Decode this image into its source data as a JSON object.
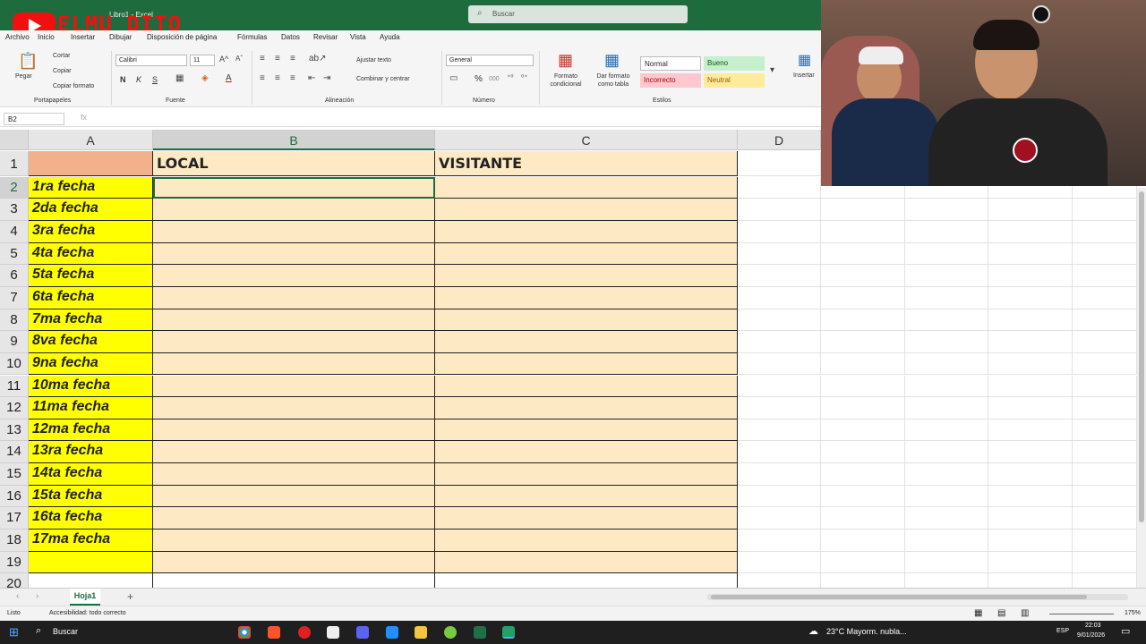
{
  "window": {
    "title": "Libro1 - Excel",
    "watermark": "ELMU_DITO",
    "search_placeholder": "Buscar"
  },
  "menu": {
    "items": [
      "Archivo",
      "Inicio",
      "Insertar",
      "Dibujar",
      "Disposición de página",
      "Fórmulas",
      "Datos",
      "Revisar",
      "Vista",
      "Ayuda"
    ]
  },
  "ribbon": {
    "paste": "Pegar",
    "cut": "Cortar",
    "copy": "Copiar",
    "format_painter": "Copiar formato",
    "clipboard_group": "Portapapeles",
    "font_name": "Calibri",
    "font_size": "11",
    "bold": "N",
    "italic": "K",
    "underline": "S",
    "font_group": "Fuente",
    "wrap_text": "Ajustar texto",
    "merge_center": "Combinar y centrar",
    "alignment_group": "Alineación",
    "number_format": "General",
    "percent": "%",
    "thousands": "000",
    "number_group": "Número",
    "conditional_format": "Formato condicional",
    "format_table": "Dar formato como tabla",
    "styles": {
      "normal": "Normal",
      "good": "Bueno",
      "bad": "Incorrecto",
      "neutral": "Neutral"
    },
    "styles_group": "Estilos",
    "insert": "Insertar"
  },
  "formula_bar": {
    "name_box": "B2",
    "fx": "fx",
    "value": ""
  },
  "sheet": {
    "columns": [
      "A",
      "B",
      "C",
      "D"
    ],
    "rows": [
      "1",
      "2",
      "3",
      "4",
      "5",
      "6",
      "7",
      "8",
      "9",
      "10",
      "11",
      "12",
      "13",
      "14",
      "15",
      "16",
      "17",
      "18",
      "19",
      "20"
    ],
    "header_b": "LOCAL",
    "header_c": "VISITANTE",
    "col_a": [
      "",
      "1ra fecha",
      "2da fecha",
      "3ra fecha",
      "4ta fecha",
      "5ta fecha",
      "6ta fecha",
      "7ma fecha",
      "8va fecha",
      "9na fecha",
      "10ma fecha",
      "11ma fecha",
      "12ma fecha",
      "13ra fecha",
      "14ta fecha",
      "15ta fecha",
      "16ta fecha",
      "17ma fecha",
      ""
    ],
    "colors": {
      "col_a_header": "#f2b08b",
      "col_a": "#ffff00",
      "body": "#fde9c3"
    }
  },
  "tabs": {
    "active": "Hoja1",
    "add": "+"
  },
  "status": {
    "ready": "Listo",
    "accessibility": "Accesibilidad: todo correcto",
    "zoom": "175%"
  },
  "taskbar": {
    "search": "Buscar",
    "weather": "23°C  Mayorm. nubla...",
    "lang": "ESP",
    "time": "22:03",
    "date": "9/01/2026"
  }
}
